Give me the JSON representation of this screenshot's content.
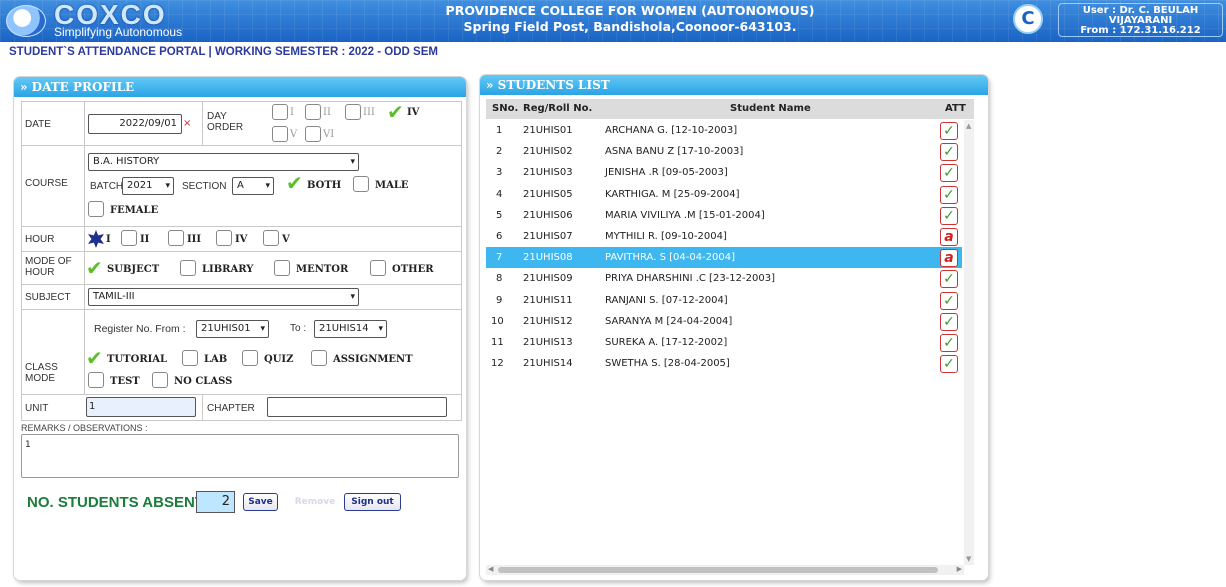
{
  "header": {
    "logo": "COXCO",
    "logo_sub": "Simplifying Autonomous",
    "college_line1": "PROVIDENCE COLLEGE FOR WOMEN (AUTONOMOUS)",
    "college_line2": "Spring Field Post, Bandishola,Coonoor-643103.",
    "user_line1": "User : Dr. C. BEULAH",
    "user_line2": "VIJAYARANI",
    "user_line3": "From : 172.31.16.212"
  },
  "portal_title": "STUDENT`S ATTENDANCE PORTAL | WORKING SEMESTER : 2022 - ODD SEM",
  "date_profile": {
    "heading": "» DATE PROFILE",
    "date_label": "DATE",
    "date_value": "2022/09/01",
    "required_mark": "×",
    "day_order_label": "DAY ORDER",
    "day_orders": [
      "I",
      "II",
      "III",
      "IV",
      "V",
      "VI"
    ],
    "day_order_selected": "IV",
    "course_label": "COURSE",
    "course_value": "B.A. HISTORY",
    "batch_label": "BATCH",
    "batch_value": "2021",
    "section_label": "SECTION",
    "section_value": "A",
    "gender_options": [
      "BOTH",
      "MALE",
      "FEMALE"
    ],
    "gender_selected": "BOTH",
    "hour_label": "HOUR",
    "hours": [
      "I",
      "II",
      "III",
      "IV",
      "V"
    ],
    "hour_selected": "I",
    "mode_label": "MODE OF HOUR",
    "modes": [
      "SUBJECT",
      "LIBRARY",
      "MENTOR",
      "OTHER"
    ],
    "mode_selected": "SUBJECT",
    "subject_label": "SUBJECT",
    "subject_value": "TAMIL-III",
    "register_from_label": "Register No. From :",
    "register_from_value": "21UHIS01",
    "register_to_label": "To :",
    "register_to_value": "21UHIS14",
    "class_mode_label": "CLASS MODE",
    "class_modes": [
      "TUTORIAL",
      "LAB",
      "QUIZ",
      "ASSIGNMENT",
      "TEST",
      "NO CLASS"
    ],
    "class_mode_selected": "TUTORIAL",
    "unit_label": "UNIT",
    "unit_value": "1",
    "chapter_label": "CHAPTER",
    "chapter_value": "",
    "remarks_label": "REMARKS / OBSERVATIONS :",
    "remarks_value": "1",
    "absent_label": "NO. STUDENTS ABSENT :",
    "absent_count": "2",
    "save_label": "Save",
    "remove_label": "Remove",
    "signout_label": "Sign out"
  },
  "students_list": {
    "heading": "» STUDENTS LIST",
    "columns": [
      "SNo.",
      "Reg/Roll No.",
      "Student Name",
      "ATT"
    ],
    "rows": [
      {
        "sno": "1",
        "reg": "21UHIS01",
        "name": "ARCHANA G. [12-10-2003]",
        "att": "present"
      },
      {
        "sno": "2",
        "reg": "21UHIS02",
        "name": "ASNA BANU Z [17-10-2003]",
        "att": "present"
      },
      {
        "sno": "3",
        "reg": "21UHIS03",
        "name": "JENISHA .R [09-05-2003]",
        "att": "present"
      },
      {
        "sno": "4",
        "reg": "21UHIS05",
        "name": "KARTHIGA. M [25-09-2004]",
        "att": "present"
      },
      {
        "sno": "5",
        "reg": "21UHIS06",
        "name": "MARIA VIVILIYA .M [15-01-2004]",
        "att": "present"
      },
      {
        "sno": "6",
        "reg": "21UHIS07",
        "name": "MYTHILI R. [09-10-2004]",
        "att": "absent"
      },
      {
        "sno": "7",
        "reg": "21UHIS08",
        "name": "PAVITHRA. S [04-04-2004]",
        "att": "absent"
      },
      {
        "sno": "8",
        "reg": "21UHIS09",
        "name": "PRIYA DHARSHINI .C [23-12-2003]",
        "att": "present"
      },
      {
        "sno": "9",
        "reg": "21UHIS11",
        "name": "RANJANI S. [07-12-2004]",
        "att": "present"
      },
      {
        "sno": "10",
        "reg": "21UHIS12",
        "name": "SARANYA M [24-04-2004]",
        "att": "present"
      },
      {
        "sno": "11",
        "reg": "21UHIS13",
        "name": "SUREKA A. [17-12-2002]",
        "att": "present"
      },
      {
        "sno": "12",
        "reg": "21UHIS14",
        "name": "SWETHA S. [28-04-2005]",
        "att": "present"
      }
    ],
    "selected_row": "7",
    "present_glyph": "✓",
    "absent_glyph": "a"
  }
}
